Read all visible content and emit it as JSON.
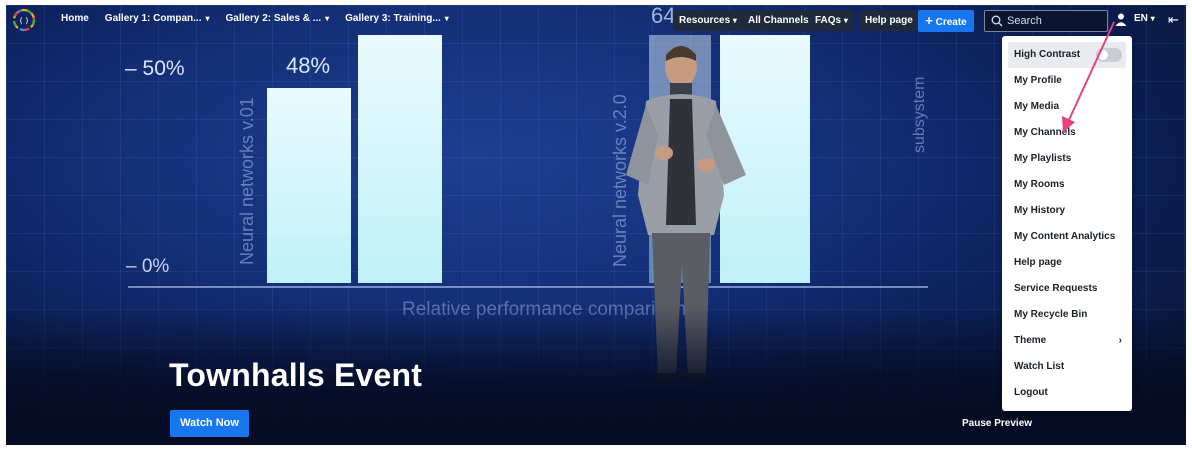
{
  "nav": {
    "items": [
      {
        "label": "Home",
        "has_dropdown": false
      },
      {
        "label": "Gallery 1: Compan...",
        "has_dropdown": true
      },
      {
        "label": "Gallery 2: Sales & ...",
        "has_dropdown": true
      },
      {
        "label": "Gallery 3: Training...",
        "has_dropdown": true
      }
    ],
    "resources_label": "Resources",
    "all_channels_label": "All Channels",
    "faqs_label": "FAQs",
    "help_label": "Help page",
    "create_label": "Create",
    "search_placeholder": "Search",
    "language": "EN"
  },
  "hero": {
    "backdrop": {
      "tick_top": "– 50%",
      "bar_value_1": "48%",
      "bar_value_2": "64",
      "tick_bottom": "– 0%",
      "label_1": "Neural networks v.01",
      "label_2": "Neural networks v.2.0",
      "label_3": "subsystem",
      "axis_title": "Relative performance comparison"
    },
    "title": "Townhalls Event",
    "watch_label": "Watch Now",
    "pause_label": "Pause Preview"
  },
  "user_menu": {
    "items": [
      {
        "label": "High Contrast",
        "type": "toggle",
        "checked": false
      },
      {
        "label": "My Profile"
      },
      {
        "label": "My Media"
      },
      {
        "label": "My Channels"
      },
      {
        "label": "My Playlists"
      },
      {
        "label": "My Rooms"
      },
      {
        "label": "My History"
      },
      {
        "label": "My Content Analytics"
      },
      {
        "label": "Help page"
      },
      {
        "label": "Service Requests"
      },
      {
        "label": "My Recycle Bin"
      },
      {
        "label": "Theme",
        "has_submenu": true
      },
      {
        "label": "Watch List"
      },
      {
        "label": "Logout"
      }
    ]
  },
  "colors": {
    "accent": "#1677f0",
    "annotation_arrow": "#e8417f",
    "nav_pill": "#1f2b3d"
  }
}
